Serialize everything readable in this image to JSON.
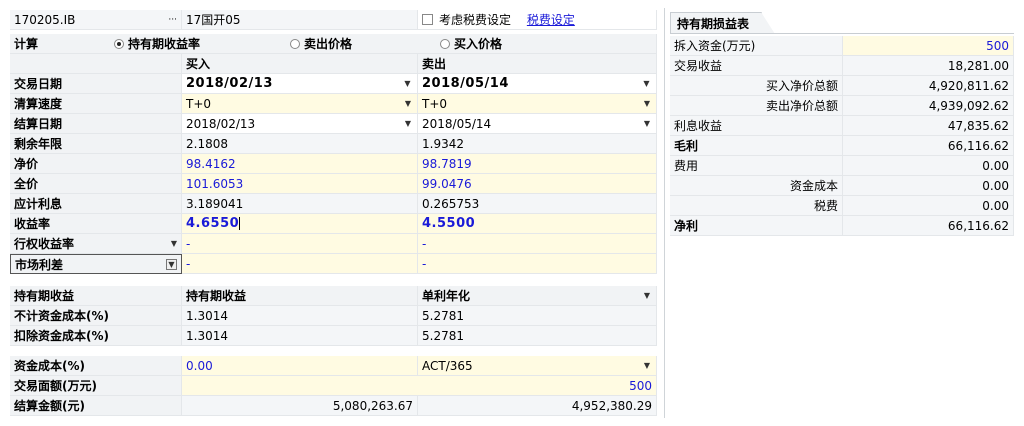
{
  "top": {
    "code": "170205.IB",
    "ellipsis": "···",
    "bond_name": "17国开05",
    "checkbox_label": "考虑税费设定",
    "tax_link": "税费设定"
  },
  "calc_row": {
    "label": "计算",
    "option1": "持有期收益率",
    "option2": "卖出价格",
    "option3": "买入价格"
  },
  "columns": {
    "buy": "买入",
    "sell": "卖出"
  },
  "rows": {
    "trade_date": {
      "label": "交易日期",
      "buy": "2018/02/13",
      "sell": "2018/05/14"
    },
    "settle_speed": {
      "label": "清算速度",
      "buy": "T+0",
      "sell": "T+0"
    },
    "settle_date": {
      "label": "结算日期",
      "buy": "2018/02/13",
      "sell": "2018/05/14"
    },
    "remaining": {
      "label": "剩余年限",
      "buy": "2.1808",
      "sell": "1.9342"
    },
    "clean_price": {
      "label": "净价",
      "buy": "98.4162",
      "sell": "98.7819"
    },
    "full_price": {
      "label": "全价",
      "buy": "101.6053",
      "sell": "99.0476"
    },
    "accrued": {
      "label": "应计利息",
      "buy": "3.189041",
      "sell": "0.265753"
    },
    "yield": {
      "label": "收益率",
      "buy": "4.6550",
      "sell": "4.5500"
    },
    "exercise_yield": {
      "label": "行权收益率",
      "buy": "-",
      "sell": "-"
    },
    "market_spread": {
      "label": "市场利差",
      "buy": "-",
      "sell": "-"
    }
  },
  "holding": {
    "header": {
      "label": "持有期收益",
      "col2": "持有期收益",
      "col3": "单利年化"
    },
    "no_cost": {
      "label": "不计资金成本(%)",
      "buy": "1.3014",
      "sell": "5.2781"
    },
    "with_cost": {
      "label": "扣除资金成本(%)",
      "buy": "1.3014",
      "sell": "5.2781"
    }
  },
  "funding": {
    "cost": {
      "label": "资金成本(%)",
      "value": "0.00",
      "basis": "ACT/365"
    },
    "face": {
      "label": "交易面额(万元)",
      "value": "500"
    },
    "settle_amount": {
      "label": "结算金额(元)",
      "buy": "5,080,263.67",
      "sell": "4,952,380.29"
    }
  },
  "pnl": {
    "tab": "持有期损益表",
    "rows": [
      {
        "label": "拆入资金(万元)",
        "value": "500"
      },
      {
        "label": "交易收益",
        "value": "18,281.00"
      },
      {
        "label": "买入净价总额",
        "value": "4,920,811.62"
      },
      {
        "label": "卖出净价总额",
        "value": "4,939,092.62"
      },
      {
        "label": "利息收益",
        "value": "47,835.62"
      },
      {
        "label": "毛利",
        "value": "66,116.62"
      },
      {
        "label": "费用",
        "value": "0.00"
      },
      {
        "label": "资金成本",
        "value": "0.00"
      },
      {
        "label": "税费",
        "value": "0.00"
      },
      {
        "label": "净利",
        "value": "66,116.62"
      }
    ]
  }
}
